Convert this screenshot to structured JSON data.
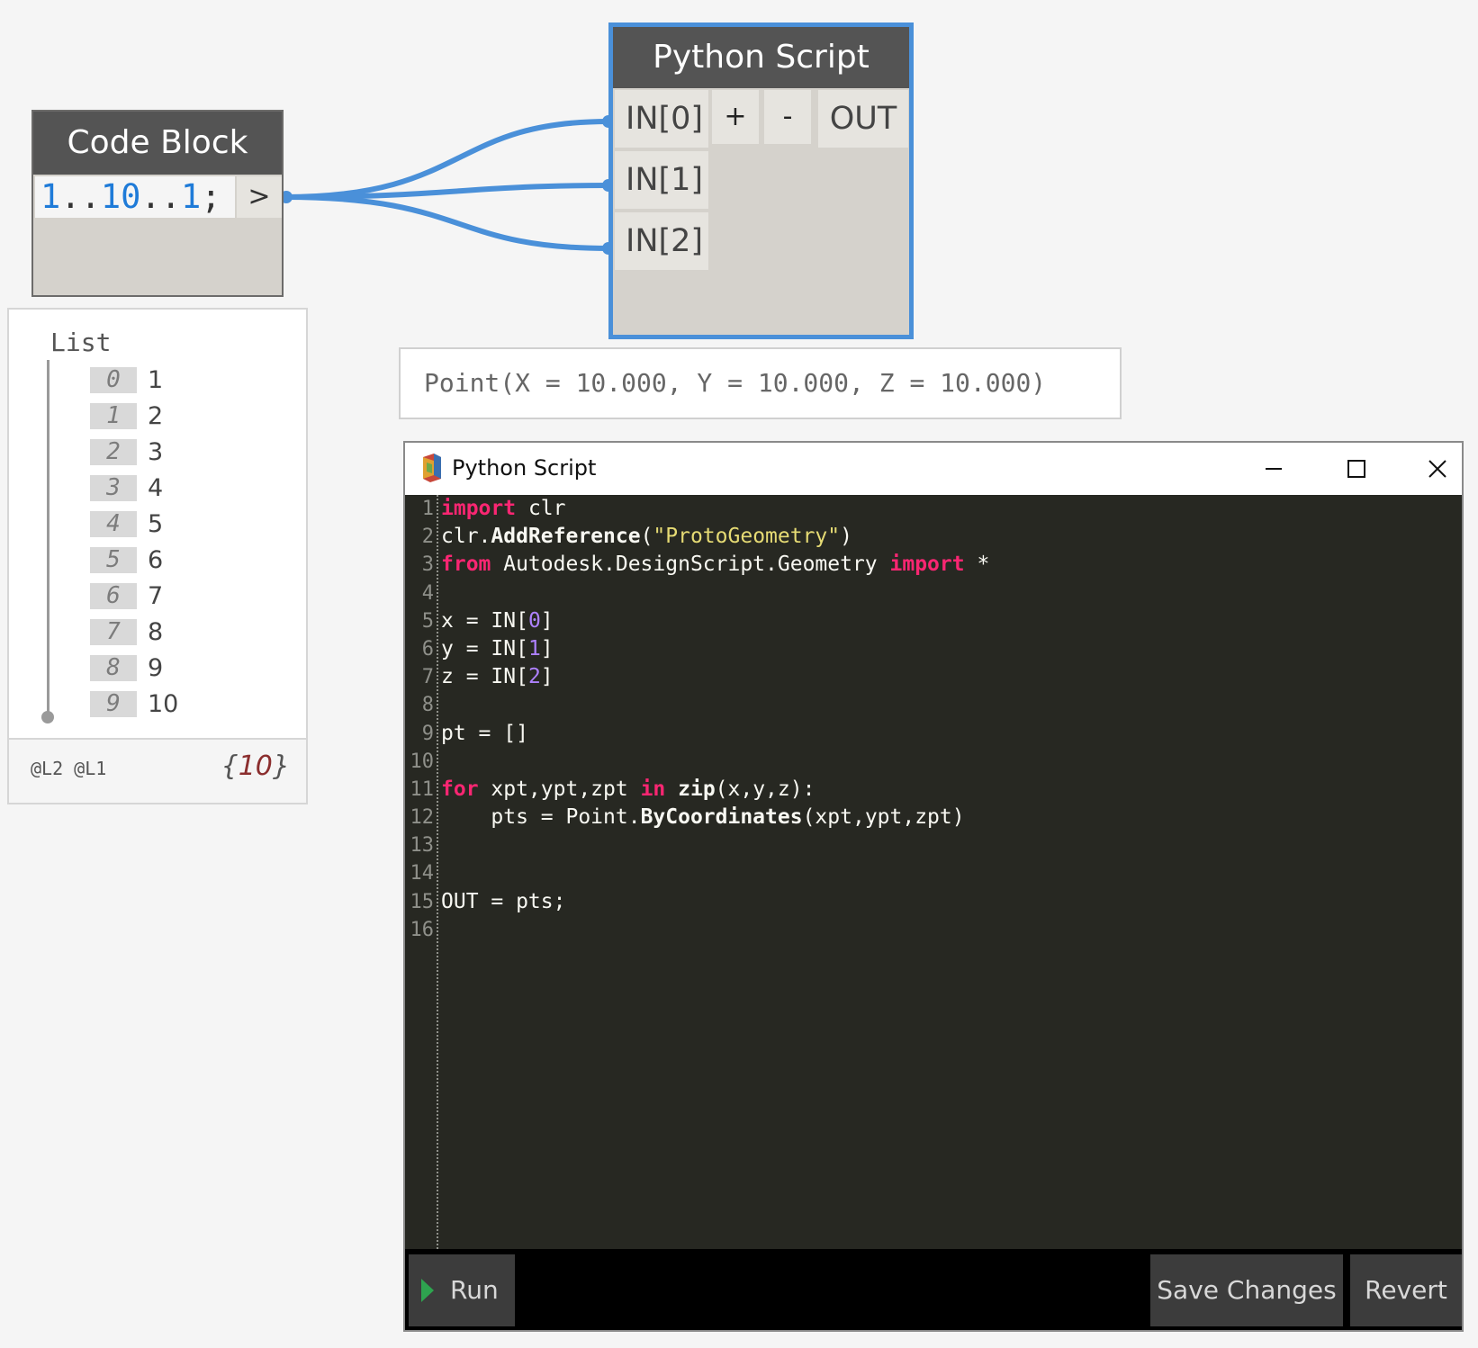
{
  "code_block": {
    "title": "Code Block",
    "code": {
      "n1": "1",
      "sep1": "..",
      "n2": "10",
      "sep2": "..",
      "n3": "1",
      "end": ";"
    },
    "output_port": ">"
  },
  "watch": {
    "label": "List",
    "items": [
      {
        "index": "0",
        "value": "1"
      },
      {
        "index": "1",
        "value": "2"
      },
      {
        "index": "2",
        "value": "3"
      },
      {
        "index": "3",
        "value": "4"
      },
      {
        "index": "4",
        "value": "5"
      },
      {
        "index": "5",
        "value": "6"
      },
      {
        "index": "6",
        "value": "7"
      },
      {
        "index": "7",
        "value": "8"
      },
      {
        "index": "8",
        "value": "9"
      },
      {
        "index": "9",
        "value": "10"
      }
    ],
    "levels": "@L2 @L1",
    "count_open": "{",
    "count": "10",
    "count_close": "}"
  },
  "python_node": {
    "title": "Python Script",
    "inputs": [
      "IN[0]",
      "IN[1]",
      "IN[2]"
    ],
    "add_label": "+",
    "remove_label": "-",
    "output": "OUT"
  },
  "result_preview": "Point(X = 10.000, Y = 10.000, Z = 10.000)",
  "editor": {
    "title": "Python Script",
    "line_numbers": [
      "1",
      "2",
      "3",
      "4",
      "5",
      "6",
      "7",
      "8",
      "9",
      "10",
      "11",
      "12",
      "13",
      "14",
      "15",
      "16"
    ],
    "code": {
      "l1": {
        "kw": "import",
        "rest": " clr"
      },
      "l2": {
        "a": "clr.",
        "fn": "AddReference",
        "b": "(",
        "str": "\"ProtoGeometry\"",
        "c": ")"
      },
      "l3": {
        "kw1": "from",
        "mid": " Autodesk.DesignScript.Geometry ",
        "kw2": "import",
        "end": " *"
      },
      "l5": {
        "a": "x = IN[",
        "n": "0",
        "b": "]"
      },
      "l6": {
        "a": "y = IN[",
        "n": "1",
        "b": "]"
      },
      "l7": {
        "a": "z = IN[",
        "n": "2",
        "b": "]"
      },
      "l9": "pt = []",
      "l11": {
        "kw1": "for",
        "a": " xpt,ypt,zpt ",
        "kw2": "in",
        "b": " ",
        "fn": "zip",
        "c": "(x,y,z):"
      },
      "l12": {
        "a": "    pts = Point.",
        "fn": "ByCoordinates",
        "b": "(xpt,ypt,zpt)"
      },
      "l15": "OUT = pts;"
    },
    "buttons": {
      "run": "Run",
      "save": "Save Changes",
      "revert": "Revert"
    }
  },
  "colors": {
    "wire": "#4a90d9",
    "selection": "#4a90d9",
    "editor_bg": "#272822",
    "keyword": "#f92672",
    "string": "#e6db74",
    "number": "#ae81ff"
  }
}
